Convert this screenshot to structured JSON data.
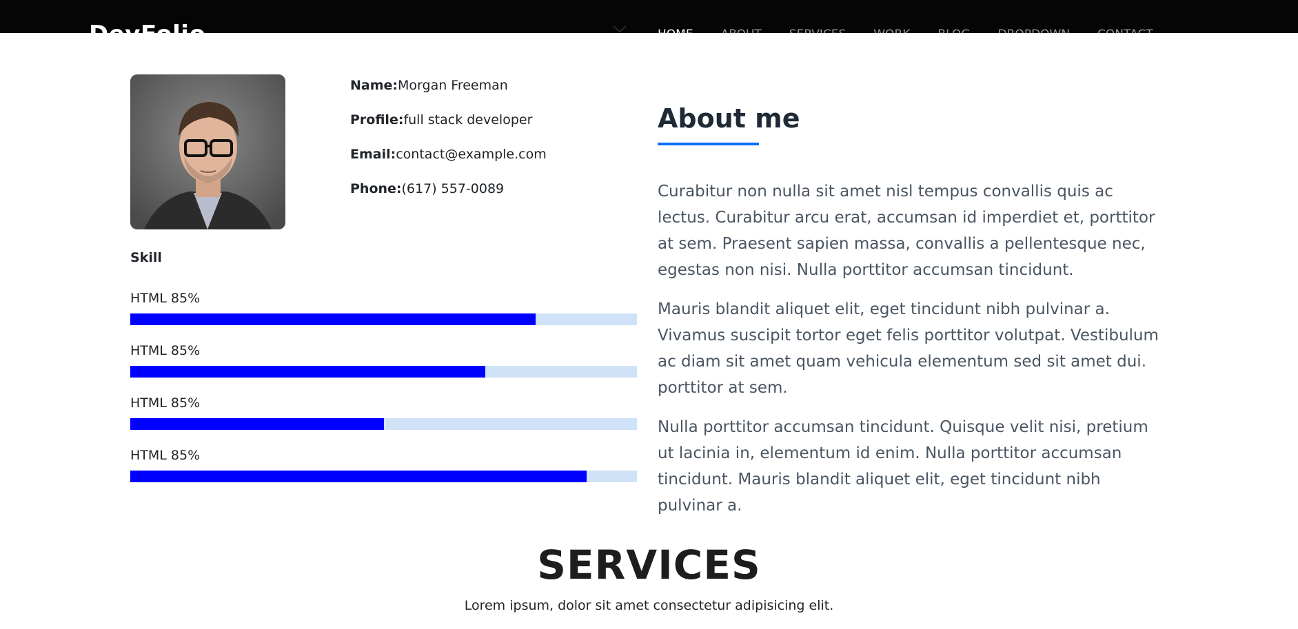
{
  "navbar": {
    "brand": "DevFolio",
    "links": [
      {
        "label": "HOME",
        "active": true
      },
      {
        "label": "ABOUT",
        "active": false
      },
      {
        "label": "SERVICES",
        "active": false
      },
      {
        "label": "WORK",
        "active": false
      },
      {
        "label": "BLOG",
        "active": false
      },
      {
        "label": "DROPDOWN",
        "active": false
      },
      {
        "label": "CONTACT",
        "active": false
      }
    ]
  },
  "profile": {
    "name_label": "Name:",
    "name": "Morgan Freeman",
    "profile_label": "Profile:",
    "profile": "full stack developer",
    "email_label": "Email:",
    "email": "contact@example.com",
    "phone_label": "Phone:",
    "phone": "(617) 557-0089"
  },
  "skills": {
    "title": "Skill",
    "items": [
      {
        "label": "HTML 85%",
        "progress": 0.8
      },
      {
        "label": "HTML 85%",
        "progress": 0.7
      },
      {
        "label": "HTML 85%",
        "progress": 0.5
      },
      {
        "label": "HTML 85%",
        "progress": 0.9
      }
    ]
  },
  "about": {
    "title": "About me",
    "paragraphs": [
      "Curabitur non nulla sit amet nisl tempus convallis quis ac lectus. Curabitur arcu erat, accumsan id imperdiet et, porttitor at sem. Praesent sapien massa, convallis a pellentesque nec, egestas non nisi. Nulla porttitor accumsan tincidunt.",
      "Mauris blandit aliquet elit, eget tincidunt nibh pulvinar a. Vivamus suscipit tortor eget felis porttitor volutpat. Vestibulum ac diam sit amet quam vehicula elementum sed sit amet dui. porttitor at sem.",
      "Nulla porttitor accumsan tincidunt. Quisque velit nisi, pretium ut lacinia in, elementum id enim. Nulla porttitor accumsan tincidunt. Mauris blandit aliquet elit, eget tincidunt nibh pulvinar a."
    ]
  },
  "services": {
    "title": "SERVICES",
    "subtitle": "Lorem ipsum, dolor sit amet consectetur adipisicing elit."
  },
  "colors": {
    "navbar_bg": "#050505",
    "accent": "#0d6efd",
    "skill_fill": "#0000ff",
    "skill_track": "#cfe2f7"
  }
}
